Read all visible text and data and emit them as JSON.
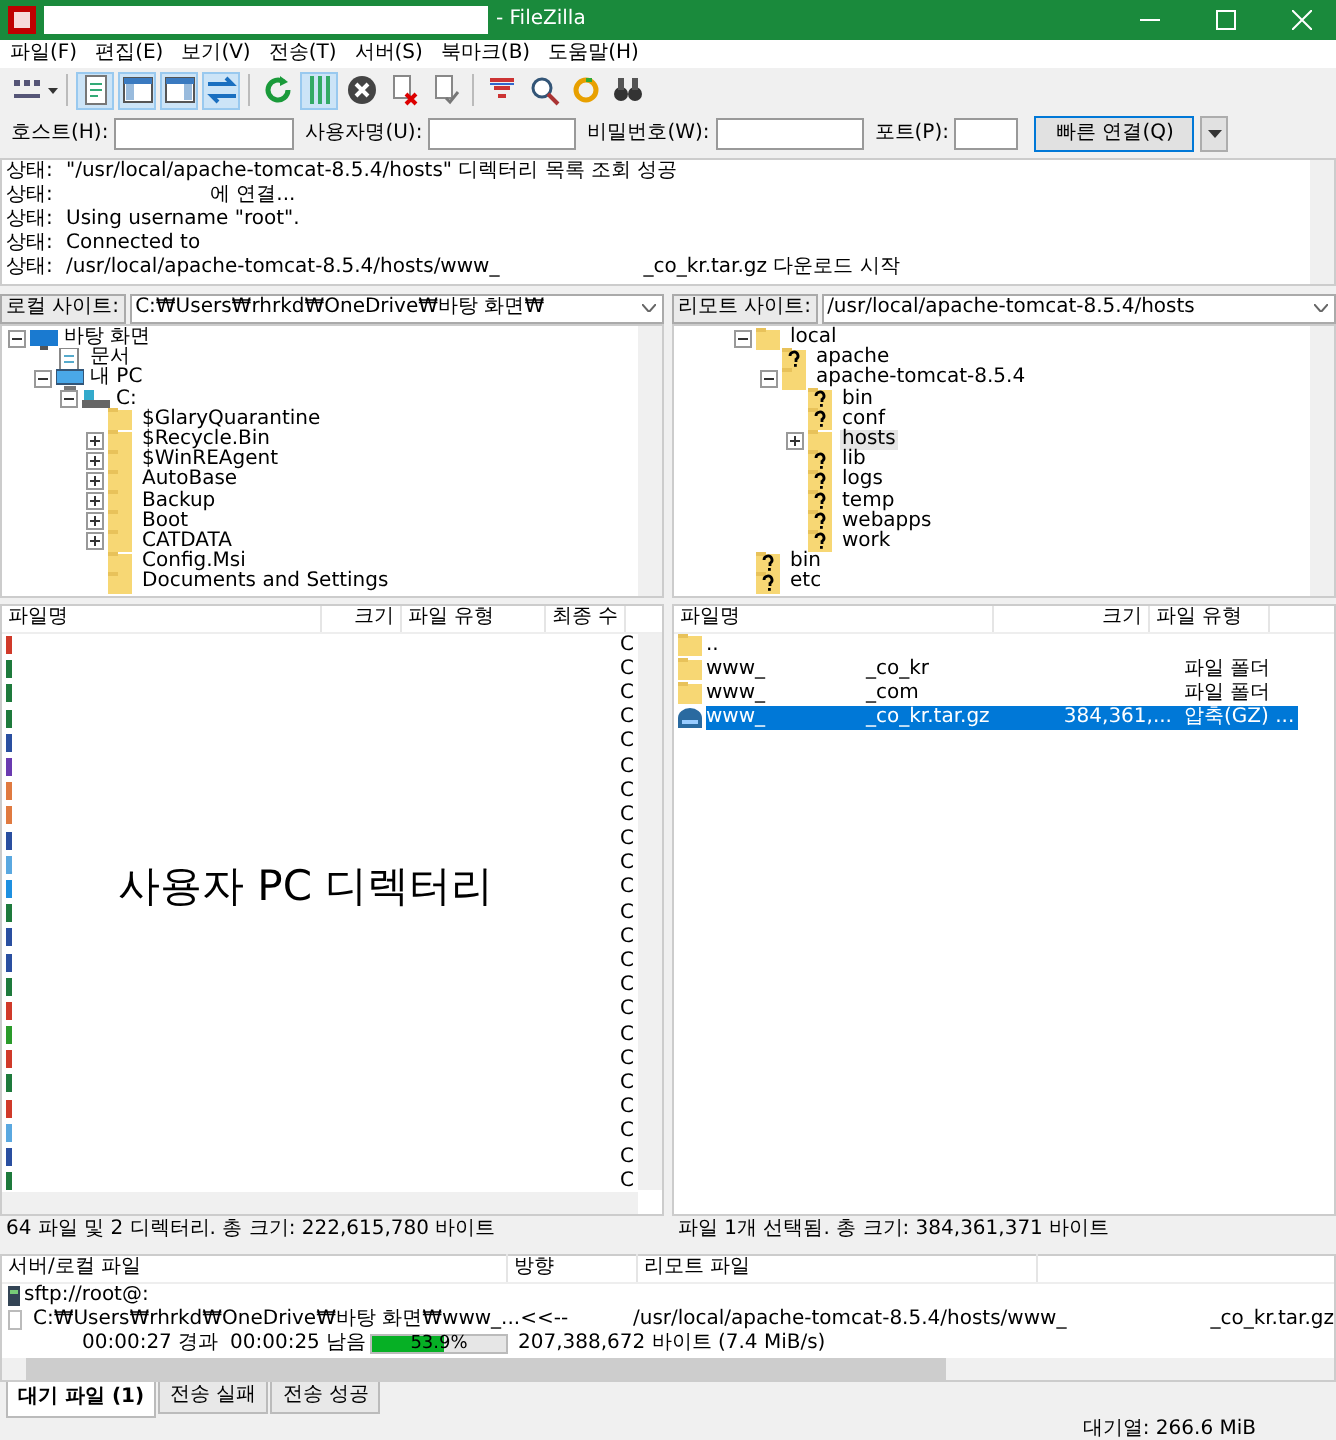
{
  "window": {
    "title": "- FileZilla"
  },
  "menu": [
    "파일(F)",
    "편집(E)",
    "보기(V)",
    "전송(T)",
    "서버(S)",
    "북마크(B)",
    "도움말(H)"
  ],
  "toolbar": [
    {
      "kind": "site-manager",
      "on": false
    },
    {
      "kind": "log",
      "on": true
    },
    {
      "kind": "local-tree",
      "on": true
    },
    {
      "kind": "remote-tree",
      "on": true
    },
    {
      "kind": "queue",
      "on": true
    },
    {
      "kind": "refresh",
      "on": false
    },
    {
      "kind": "compare",
      "on": true
    },
    {
      "kind": "cancel",
      "on": false
    },
    {
      "kind": "disconnect",
      "on": false
    },
    {
      "kind": "reconnect",
      "on": false
    },
    {
      "kind": "filter",
      "on": false
    },
    {
      "kind": "search",
      "on": false
    },
    {
      "kind": "sync",
      "on": false
    },
    {
      "kind": "find",
      "on": false
    }
  ],
  "quickconnect": {
    "fields": [
      {
        "label": "호스트(H):"
      },
      {
        "label": "사용자명(U):"
      },
      {
        "label": "비밀번호(W):"
      },
      {
        "label": "포트(P):"
      }
    ],
    "button": "빠른 연결(Q)"
  },
  "log": [
    {
      "label": "상태:",
      "parts": [
        "\"/usr/local/apache-tomcat-8.5.4/hosts\" 디렉터리 목록 조회 성공"
      ]
    },
    {
      "label": "상태:",
      "lead_gap": true,
      "parts": [
        "에 연결..."
      ]
    },
    {
      "label": "상태:",
      "parts": [
        "Using username \"root\"."
      ]
    },
    {
      "label": "상태:",
      "parts": [
        "Connected to"
      ]
    },
    {
      "label": "상태:",
      "parts": [
        "/usr/local/apache-tomcat-8.5.4/hosts/www_",
        "_co_kr.tar.gz 다운로드 시작"
      ]
    }
  ],
  "local_site": {
    "label": "로컬 사이트:",
    "path": "C:₩Users₩rhrkd₩OneDrive₩바탕 화면₩"
  },
  "local_tree": [
    {
      "name": "바탕 화면",
      "kind": "desktop",
      "expanded": true,
      "selected": false,
      "children": [
        {
          "name": "문서",
          "kind": "document",
          "selected": false
        },
        {
          "name": "내 PC",
          "kind": "pc",
          "expanded": true,
          "selected": false,
          "children": [
            {
              "name": "C:",
              "kind": "drive",
              "expanded": true,
              "selected": false,
              "children": [
                {
                  "name": "$GlaryQuarantine",
                  "kind": "folder",
                  "selected": false
                },
                {
                  "name": "$Recycle.Bin",
                  "kind": "folder",
                  "expanded": false,
                  "selected": false
                },
                {
                  "name": "$WinREAgent",
                  "kind": "folder",
                  "expanded": false,
                  "selected": false
                },
                {
                  "name": "AutoBase",
                  "kind": "folder",
                  "expanded": false,
                  "selected": false
                },
                {
                  "name": "Backup",
                  "kind": "folder",
                  "expanded": false,
                  "selected": false
                },
                {
                  "name": "Boot",
                  "kind": "folder",
                  "expanded": false,
                  "selected": false
                },
                {
                  "name": "CATDATA",
                  "kind": "folder",
                  "expanded": false,
                  "selected": false
                },
                {
                  "name": "Config.Msi",
                  "kind": "folder",
                  "selected": false
                },
                {
                  "name": "Documents and Settings",
                  "kind": "folder",
                  "selected": false
                }
              ]
            }
          ]
        }
      ]
    }
  ],
  "remote_site": {
    "label": "리모트 사이트:",
    "path": "/usr/local/apache-tomcat-8.5.4/hosts"
  },
  "remote_tree": [
    {
      "name": "local",
      "kind": "folder",
      "expanded": true,
      "selected": false,
      "children": [
        {
          "name": "apache",
          "kind": "unknown",
          "selected": false
        },
        {
          "name": "apache-tomcat-8.5.4",
          "kind": "folder",
          "expanded": true,
          "selected": false,
          "children": [
            {
              "name": "bin",
              "kind": "unknown",
              "selected": false
            },
            {
              "name": "conf",
              "kind": "unknown",
              "selected": false
            },
            {
              "name": "hosts",
              "kind": "folder",
              "expanded": false,
              "selected": true
            },
            {
              "name": "lib",
              "kind": "unknown",
              "selected": false
            },
            {
              "name": "logs",
              "kind": "unknown",
              "selected": false
            },
            {
              "name": "temp",
              "kind": "unknown",
              "selected": false
            },
            {
              "name": "webapps",
              "kind": "unknown",
              "selected": false
            },
            {
              "name": "work",
              "kind": "unknown",
              "selected": false
            }
          ]
        }
      ]
    },
    {
      "name": "bin",
      "kind": "unknown",
      "selected": false
    },
    {
      "name": "etc",
      "kind": "unknown",
      "selected": false
    }
  ],
  "local_list": {
    "columns": [
      "파일명",
      "크기",
      "파일 유형",
      "최종 수"
    ],
    "rows": [
      {
        "color": "#d03a2a",
        "column_4": "C"
      },
      {
        "color": "#1e7a3c",
        "column_4": "C"
      },
      {
        "color": "#1e7a3c",
        "column_4": "C"
      },
      {
        "color": "#1e7a3c",
        "column_4": "C"
      },
      {
        "color": "#2a4fa0",
        "column_4": "C"
      },
      {
        "color": "#6a3ab0",
        "column_4": "C"
      },
      {
        "color": "#e07a40",
        "column_4": "C"
      },
      {
        "color": "#e07a40",
        "column_4": "C"
      },
      {
        "color": "#2a4fa0",
        "column_4": "C"
      },
      {
        "color": "#5aa8e0",
        "column_4": "C"
      },
      {
        "color": "#1e90e0",
        "column_4": "C"
      },
      {
        "color": "#1e7a3c",
        "column_4": "C"
      },
      {
        "color": "#2a4fa0",
        "column_4": "C"
      },
      {
        "color": "#2a4fa0",
        "column_4": "C"
      },
      {
        "color": "#1e7a3c",
        "column_4": "C"
      },
      {
        "color": "#d03a2a",
        "column_4": "C"
      },
      {
        "color": "#2a9a2a",
        "column_4": "C"
      },
      {
        "color": "#d03a2a",
        "column_4": "C"
      },
      {
        "color": "#1e7a3c",
        "column_4": "C"
      },
      {
        "color": "#d03a2a",
        "column_4": "C"
      },
      {
        "color": "#5aa8e0",
        "column_4": "C"
      },
      {
        "color": "#2a4fa0",
        "column_4": "C"
      },
      {
        "color": "#1e7a3c",
        "column_4": "C"
      }
    ],
    "annotation": "사용자 PC 디렉터리",
    "status": "64 파일 및 2 디렉터리. 총 크기: 222,615,780 바이트"
  },
  "remote_list": {
    "columns": [
      "파일명",
      "크기",
      "파일 유형"
    ],
    "rows": [
      {
        "kind": "parent",
        "name": "..",
        "selected": false
      },
      {
        "kind": "folder",
        "name": "www_",
        "name_end": "_co_kr",
        "type": "파일 폴더",
        "selected": false
      },
      {
        "kind": "folder",
        "name": "www_",
        "name_end": "_com",
        "type": "파일 폴더",
        "selected": false
      },
      {
        "kind": "archive",
        "name": "www_",
        "name_end": "_co_kr.tar.gz",
        "size": "384,361,...",
        "type": "압축(GZ) ...",
        "selected": true
      }
    ],
    "status": "파일 1개 선택됨. 총 크기: 384,361,371 바이트"
  },
  "queue": {
    "columns": [
      "서버/로컬 파일",
      "방향",
      "리모트 파일"
    ],
    "server": "sftp://root@:",
    "local": "C:₩Users₩rhrkd₩OneDrive₩바탕 화면₩www_...",
    "direction": "<<--",
    "remote": [
      "/usr/local/apache-tomcat-8.5.4/hosts/www_",
      "_co_kr.tar.gz"
    ],
    "elapsed": "00:00:27 경과",
    "remaining": "00:00:25 남음",
    "level": 0.539,
    "percent": "53.9%",
    "bytes": "207,388,672 바이트 (7.4 MiB/s)"
  },
  "tabs": [
    {
      "label": "대기 파일 (1)",
      "selected": true
    },
    {
      "label": "전송 실패",
      "selected": false
    },
    {
      "label": "전송 성공",
      "selected": false
    }
  ],
  "status_bar": {
    "queue": "대기열: 266.6 MiB"
  }
}
